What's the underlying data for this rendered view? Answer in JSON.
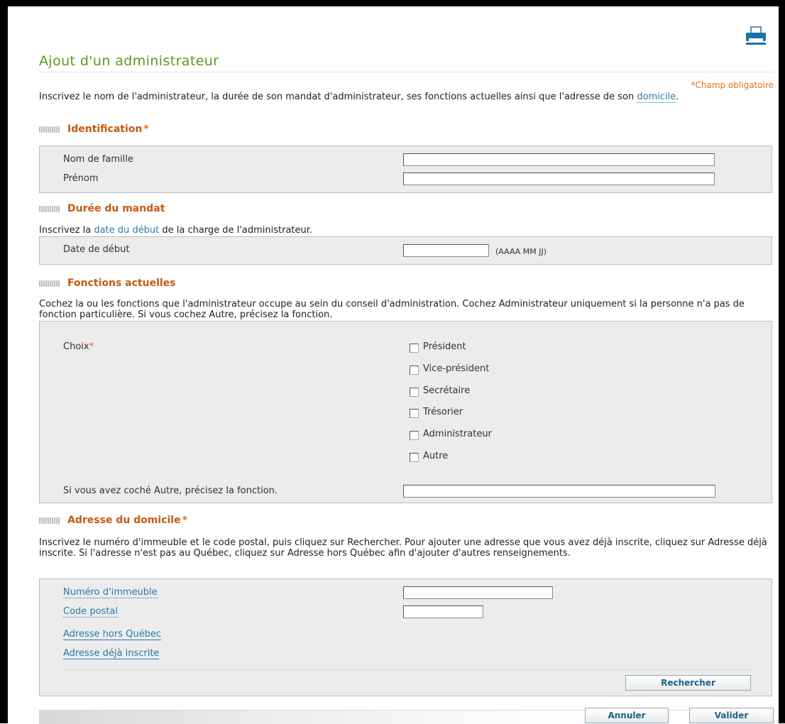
{
  "page": {
    "title": "Ajout d'un administrateur",
    "required_note": "*Champ obligatoire",
    "intro_before": "Inscrivez le nom de l'administrateur, la durée de son mandat d'administrateur, ses fonctions actuelles ainsi que l'adresse de son ",
    "intro_link": "domicile",
    "intro_after": ".",
    "print_icon": "printer-icon"
  },
  "identification": {
    "title": "Identification",
    "star": "*",
    "fields": {
      "last_name_label": "Nom de famille",
      "first_name_label": "Prénom",
      "last_name_value": "",
      "first_name_value": ""
    }
  },
  "mandat": {
    "title": "Durée du mandat",
    "text_before": "Inscrivez la ",
    "text_link": "date du début",
    "text_after": " de la charge de l'administrateur.",
    "date_label": "Date de début",
    "date_value": "",
    "date_hint": "(AAAA MM JJ)"
  },
  "fonctions": {
    "title": "Fonctions actuelles",
    "text": "Cochez la ou les fonctions que l'administrateur occupe au sein du conseil d'administration. Cochez Administrateur uniquement si la personne n'a pas de fonction particulière. Si vous cochez Autre, précisez la fonction.",
    "choice_label": "Choix",
    "choice_star": "*",
    "options": [
      "Président",
      "Vice-président",
      "Secrétaire",
      "Trésorier",
      "Administrateur",
      "Autre"
    ],
    "checked": [
      false,
      false,
      false,
      false,
      false,
      false
    ],
    "other_label": "Si vous avez coché Autre, précisez la fonction.",
    "other_value": ""
  },
  "adresse": {
    "title": "Adresse du domicile",
    "star": "*",
    "text": "Inscrivez le numéro d'immeuble et le code postal, puis cliquez sur Rechercher. Pour ajouter une adresse que vous avez déjà inscrite, cliquez sur Adresse déjà inscrite. Si l'adresse n'est pas au Québec, cliquez sur Adresse hors Québec afin d'ajouter d'autres renseignements.",
    "numero_label": "Numéro d'immeuble",
    "numero_value": "",
    "code_label": "Code postal",
    "code_value": "",
    "hors_quebec_link": "Adresse hors Québec",
    "deja_inscrite_link": "Adresse déjà inscrite",
    "search_button": "Rechercher"
  },
  "footer": {
    "cancel_button": "Annuler",
    "submit_button": "Valider"
  },
  "colors": {
    "title_green": "#5a9a1f",
    "section_orange": "#c45a10",
    "link_blue": "#2a7aa5",
    "box_gray": "#ececec"
  }
}
